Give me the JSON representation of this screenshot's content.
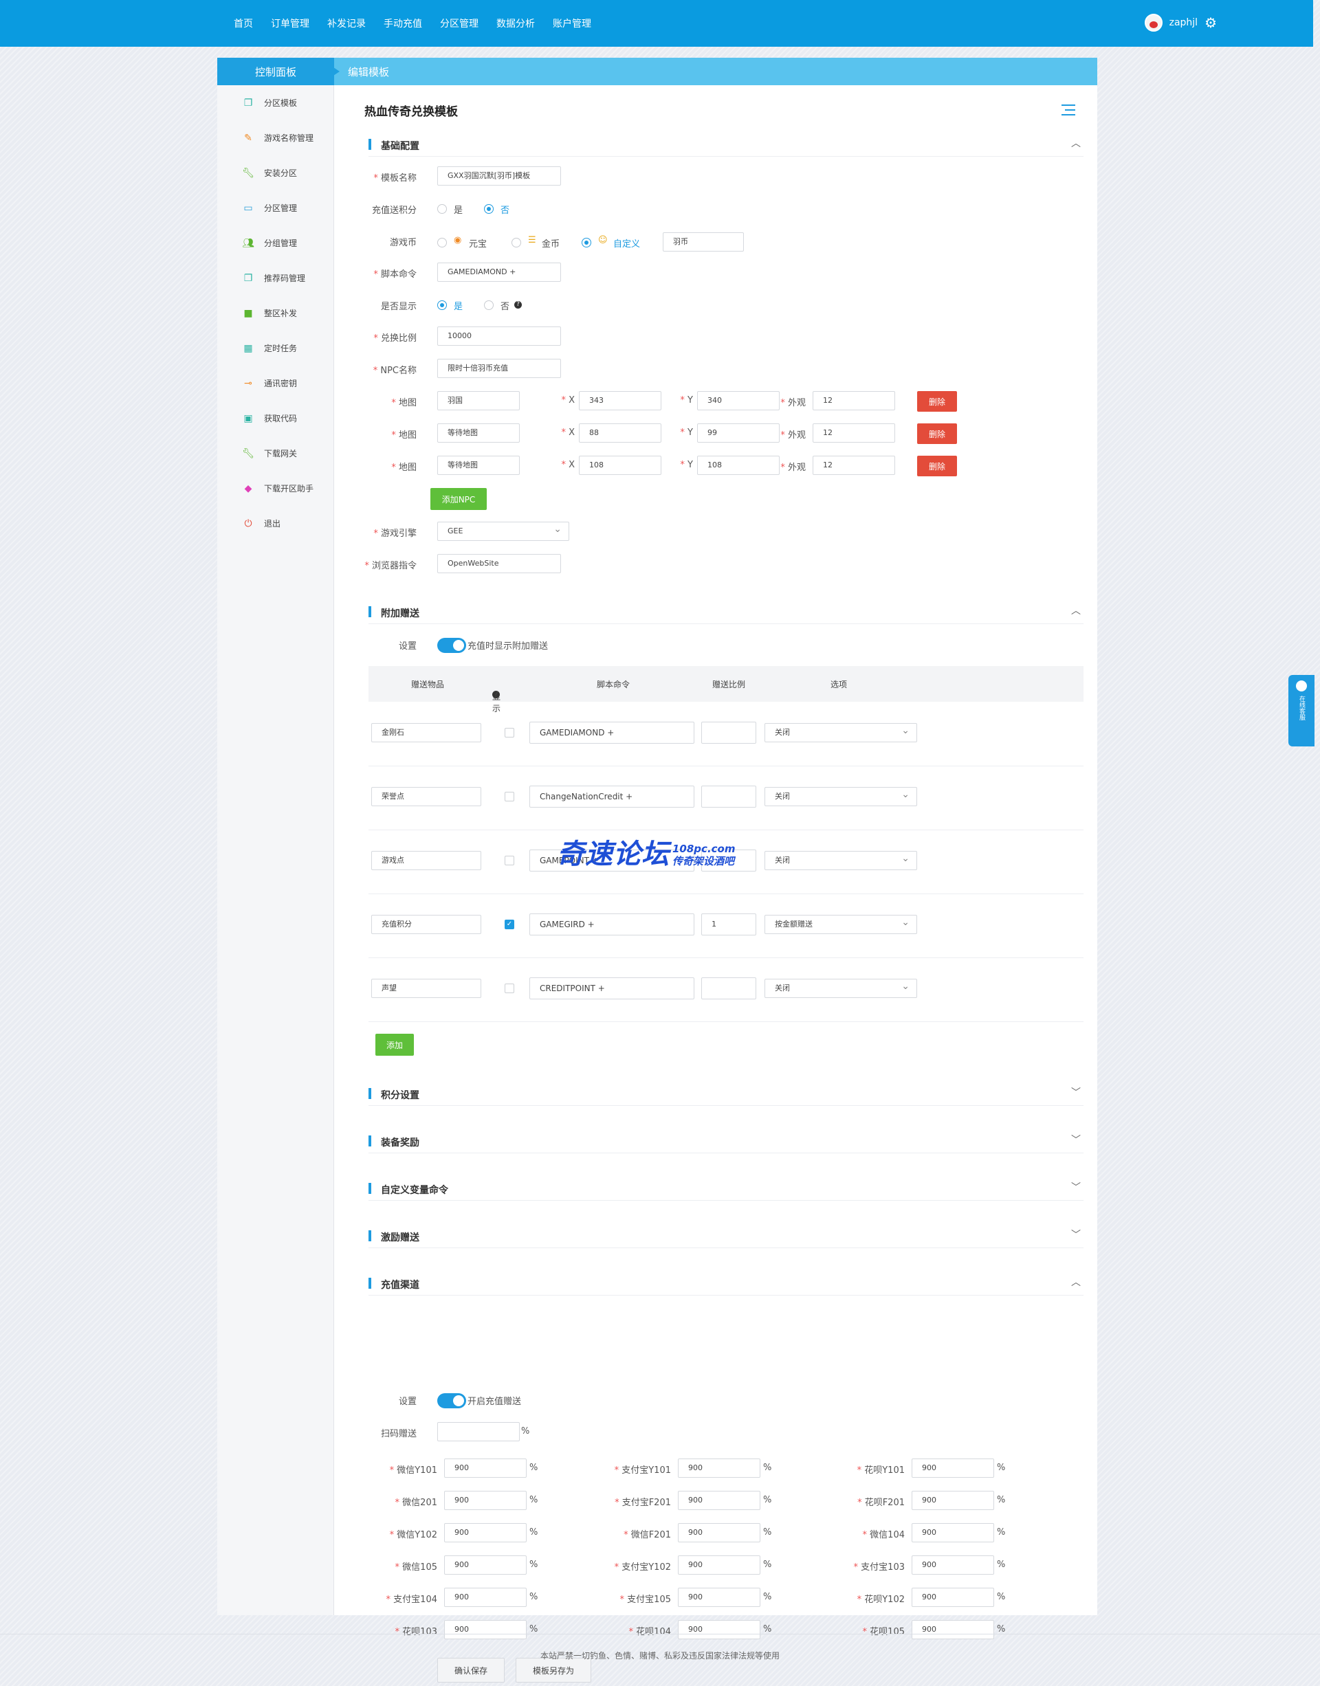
{
  "nav": {
    "items": [
      "首页",
      "订单管理",
      "补发记录",
      "手动充值",
      "分区管理",
      "数据分析",
      "账户管理"
    ],
    "username": "zaphjl"
  },
  "panel": {
    "left_title": "控制面板",
    "right_title": "编辑模板"
  },
  "sidebar": {
    "items": [
      {
        "label": "分区模板",
        "icon": "copy-icon"
      },
      {
        "label": "游戏名称管理",
        "icon": "pencil-icon"
      },
      {
        "label": "安装分区",
        "icon": "wrench-icon"
      },
      {
        "label": "分区管理",
        "icon": "inbox-icon"
      },
      {
        "label": "分组管理",
        "icon": "users-icon"
      },
      {
        "label": "推荐码管理",
        "icon": "copy-icon"
      },
      {
        "label": "整区补发",
        "icon": "folder-icon"
      },
      {
        "label": "定时任务",
        "icon": "calendar-icon"
      },
      {
        "label": "通讯密钥",
        "icon": "key-icon"
      },
      {
        "label": "获取代码",
        "icon": "briefcase-icon"
      },
      {
        "label": "下载网关",
        "icon": "wrench-icon"
      },
      {
        "label": "下载开区助手",
        "icon": "inbox-download-icon"
      },
      {
        "label": "退出",
        "icon": "power-icon"
      }
    ]
  },
  "page": {
    "title": "热血传奇兑换模板"
  },
  "basic": {
    "section_title": "基础配置",
    "template_name_label": "模板名称",
    "template_name": "GXX羽国沉默[羽币]模板",
    "recharge_points_label": "充值送积分",
    "yes": "是",
    "no": "否",
    "currency_label": "游戏币",
    "currency_opts": [
      "元宝",
      "金币",
      "自定义"
    ],
    "currency_custom": "羽币",
    "script_label": "脚本命令",
    "script": "GAMEDIAMOND +",
    "display_label": "是否显示",
    "ratio_label": "兑换比例",
    "ratio": "10000",
    "npc_label": "NPC名称",
    "npc": "限时十倍羽币充值",
    "map_label": "地图",
    "x_label": "X",
    "y_label": "Y",
    "look_label": "外观",
    "delete": "删除",
    "npc_rows": [
      {
        "map": "羽国",
        "x": "343",
        "y": "340",
        "look": "12"
      },
      {
        "map": "等待地图",
        "x": "88",
        "y": "99",
        "look": "12"
      },
      {
        "map": "等待地图",
        "x": "108",
        "y": "108",
        "look": "12"
      }
    ],
    "add_npc": "添加NPC",
    "engine_label": "游戏引擎",
    "engine": "GEE",
    "browser_label": "浏览器指令",
    "browser": "OpenWebSite"
  },
  "gift": {
    "section_title": "附加赠送",
    "setting_label": "设置",
    "toggle_text": "充值时显示附加赠送",
    "columns": [
      "赠送物品",
      "显示",
      "脚本命令",
      "赠送比例",
      "选项"
    ],
    "rows": [
      {
        "item": "金刚石",
        "checked": false,
        "cmd": "GAMEDIAMOND +",
        "ratio": "",
        "opt": "关闭"
      },
      {
        "item": "荣誉点",
        "checked": false,
        "cmd": "ChangeNationCredit +",
        "ratio": "",
        "opt": "关闭"
      },
      {
        "item": "游戏点",
        "checked": false,
        "cmd": "GAMEPOINT +",
        "ratio": "",
        "opt": "关闭"
      },
      {
        "item": "充值积分",
        "checked": true,
        "cmd": "GAMEGIRD +",
        "ratio": "1",
        "opt": "按金额赠送"
      },
      {
        "item": "声望",
        "checked": false,
        "cmd": "CREDITPOINT +",
        "ratio": "",
        "opt": "关闭"
      }
    ],
    "add": "添加"
  },
  "collapsed_sections": [
    "积分设置",
    "装备奖励",
    "自定义变量命令",
    "激励赠送"
  ],
  "channel": {
    "section_title": "充值渠道",
    "setting_label": "设置",
    "toggle_text": "开启充值赠送",
    "scan_label": "扫码赠送",
    "scan_value": "",
    "pct": "%",
    "rows": [
      [
        {
          "label": "微信Y101",
          "value": "900"
        },
        {
          "label": "支付宝Y101",
          "value": "900"
        },
        {
          "label": "花呗Y101",
          "value": "900"
        }
      ],
      [
        {
          "label": "微信201",
          "value": "900"
        },
        {
          "label": "支付宝F201",
          "value": "900"
        },
        {
          "label": "花呗F201",
          "value": "900"
        }
      ],
      [
        {
          "label": "微信Y102",
          "value": "900"
        },
        {
          "label": "微信F201",
          "value": "900"
        },
        {
          "label": "微信104",
          "value": "900"
        }
      ],
      [
        {
          "label": "微信105",
          "value": "900"
        },
        {
          "label": "支付宝Y102",
          "value": "900"
        },
        {
          "label": "支付宝103",
          "value": "900"
        }
      ],
      [
        {
          "label": "支付宝104",
          "value": "900"
        },
        {
          "label": "支付宝105",
          "value": "900"
        },
        {
          "label": "花呗Y102",
          "value": "900"
        }
      ],
      [
        {
          "label": "花呗103",
          "value": "900"
        },
        {
          "label": "花呗104",
          "value": "900"
        },
        {
          "label": "花呗105",
          "value": "900"
        }
      ]
    ]
  },
  "buttons": {
    "save": "确认保存",
    "save_as": "模板另存为"
  },
  "watermark": {
    "main": "奇速论坛",
    "site": "108pc.com",
    "sub": "传奇架设酒吧"
  },
  "service": {
    "text": "在线客服"
  },
  "footer": {
    "text": "本站严禁一切钓鱼、色情、赌博、私彩及违反国家法律法规等使用"
  },
  "colors": {
    "header": "#0a9be0",
    "accent": "#1e9be0",
    "danger": "#e34c3a",
    "success": "#5fbf3a"
  }
}
